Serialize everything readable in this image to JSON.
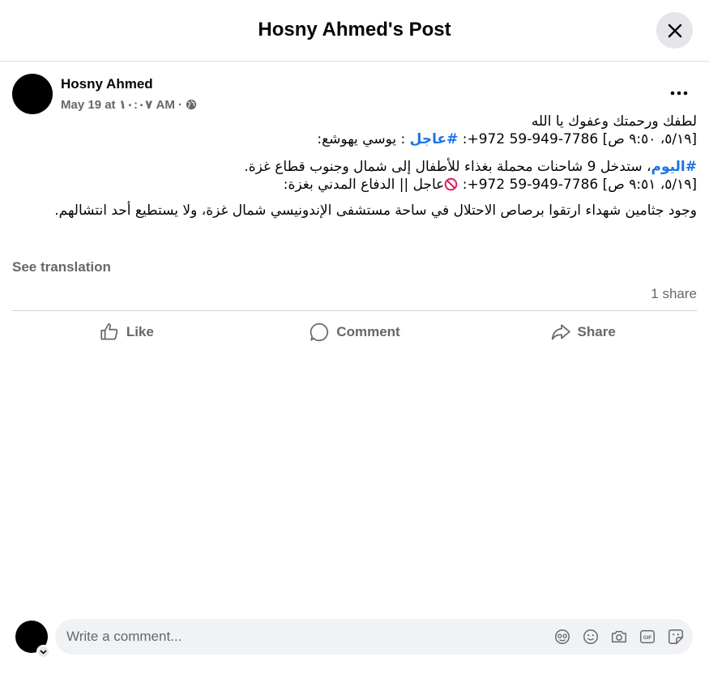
{
  "header": {
    "title": "Hosny Ahmed's Post",
    "close_icon": "close-icon"
  },
  "post": {
    "author": "Hosny Ahmed",
    "date": "May 19 at ١٠:٠٧ AM",
    "separator": "·",
    "privacy_icon": "globe-icon",
    "more_icon": "more-icon",
    "lines": {
      "l1": "لطفك  ورحمتك وعفوك يا الله",
      "l2_pre": "[٥/١٩، ٩:٥٠ ص] 7786-949-59 972+: ",
      "l2_tag": "#عاجل",
      "l2_post": " : يوسي يهوشع:",
      "l3_tag": "#اليوم",
      "l3_post": "، ستدخل 9 شاحنات محملة بغذاء للأطفال إلى شمال وجنوب قطاع غزة.",
      "l4_pre": "[٥/١٩، ٩:٥١ ص] 7786-949-59 972+: ",
      "l4_post": "عاجل || الدفاع المدني بغزة:",
      "l5": "وجود جثامين شهداء ارتقوا برصاص الاحتلال في ساحة مستشفى الإندونيسي شمال غزة، ولا يستطيع أحد انتشالهم."
    },
    "see_translation": "See translation",
    "shares": "1 share"
  },
  "actions": {
    "like": "Like",
    "comment": "Comment",
    "share": "Share"
  },
  "comment_box": {
    "placeholder": "Write a comment...",
    "tools": [
      "avatar-sticker-icon",
      "emoji-icon",
      "camera-icon",
      "gif-icon",
      "sticker-icon"
    ]
  },
  "colors": {
    "hashtag": "#1b74e4",
    "muted": "#65676b",
    "bg_field": "#f0f2f5"
  }
}
